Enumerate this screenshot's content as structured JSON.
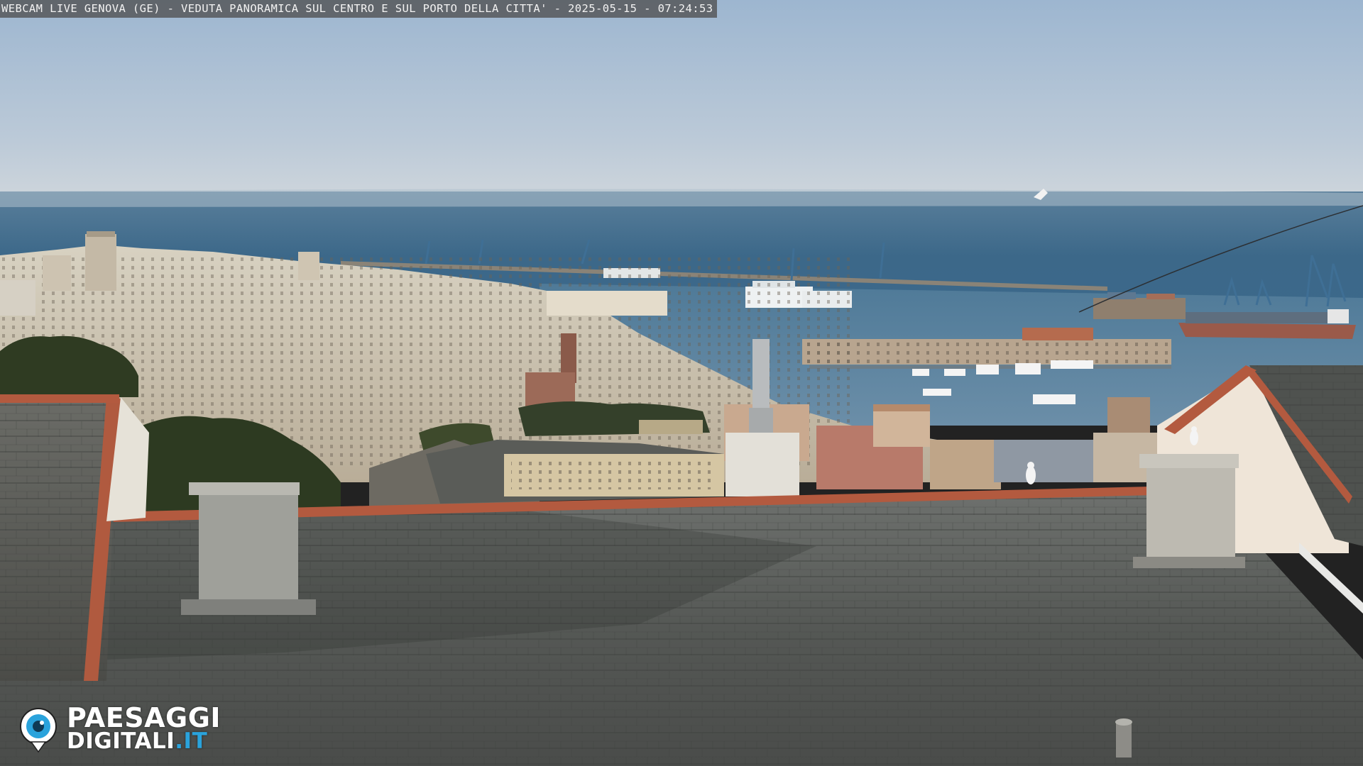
{
  "overlay": {
    "location": "WEBCAM LIVE GENOVA (GE)",
    "description": "VEDUTA PANORAMICA SUL CENTRO E SUL PORTO DELLA CITTA'",
    "date": "2025-05-15",
    "time": "07:24:53",
    "separator": " - "
  },
  "brand": {
    "line1": "PAESAGGI",
    "line2": "DIGITALI",
    "tld": ".IT",
    "mark_icon": "webcam-eye-icon",
    "colors": {
      "text": "#ffffff",
      "accent": "#2aa3dc"
    }
  },
  "colors": {
    "sky_top": "#9fb8d2",
    "sky_horizon": "#c9d3dc",
    "sea": "#3d6b8e",
    "roof": "#5b5e5c",
    "terracotta": "#b35a3f"
  }
}
